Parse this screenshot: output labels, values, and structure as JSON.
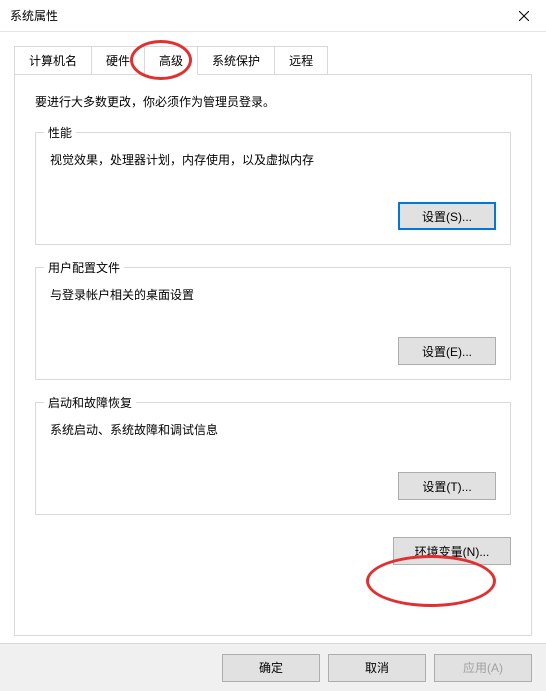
{
  "window": {
    "title": "系统属性"
  },
  "tabs": {
    "computer_name": "计算机名",
    "hardware": "硬件",
    "advanced": "高级",
    "system_protection": "系统保护",
    "remote": "远程"
  },
  "panel": {
    "intro": "要进行大多数更改，你必须作为管理员登录。",
    "performance": {
      "title": "性能",
      "desc": "视觉效果，处理器计划，内存使用，以及虚拟内存",
      "button": "设置(S)..."
    },
    "profiles": {
      "title": "用户配置文件",
      "desc": "与登录帐户相关的桌面设置",
      "button": "设置(E)..."
    },
    "startup": {
      "title": "启动和故障恢复",
      "desc": "系统启动、系统故障和调试信息",
      "button": "设置(T)..."
    },
    "env_vars_button": "环境变量(N)..."
  },
  "buttons": {
    "ok": "确定",
    "cancel": "取消",
    "apply": "应用(A)"
  }
}
